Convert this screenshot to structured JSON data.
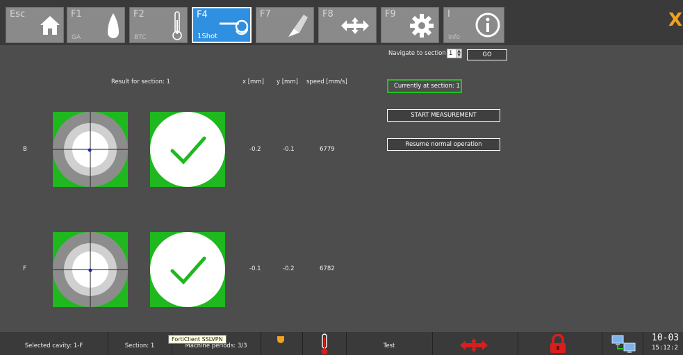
{
  "toolbar": {
    "keys": [
      {
        "key": "Esc",
        "sub": "",
        "icon": "home-icon"
      },
      {
        "key": "F1",
        "sub": "GA",
        "icon": "drop-icon"
      },
      {
        "key": "F2",
        "sub": "BTC",
        "icon": "thermometer-icon"
      },
      {
        "key": "F4",
        "sub": "1Shot",
        "icon": "probe-icon"
      },
      {
        "key": "F7",
        "sub": "",
        "icon": "brush-icon"
      },
      {
        "key": "F8",
        "sub": "",
        "icon": "arrows-icon"
      },
      {
        "key": "F9",
        "sub": "",
        "icon": "gear-icon"
      },
      {
        "key": "I",
        "sub": "Info",
        "icon": "info-icon"
      }
    ],
    "close_label": "X",
    "accent": "#f2a21f",
    "active_color": "#2f8fe0"
  },
  "results": {
    "title": "Result for section: 1",
    "col_x": "x [mm]",
    "col_y": "y [mm]",
    "col_speed": "speed [mm/s]",
    "rows": [
      {
        "label": "B",
        "x": "-0.2",
        "y": "-0.1",
        "speed": "6779"
      },
      {
        "label": "F",
        "x": "-0.1",
        "y": "-0.2",
        "speed": "6782"
      }
    ],
    "ok_color": "#1fb81f"
  },
  "navigation": {
    "label": "Navigate to section",
    "selected": "1",
    "go_label": "GO",
    "current_text": "Currently at section: 1",
    "start_label": "START MEASUREMENT",
    "resume_label": "Resume normal operation"
  },
  "status": {
    "cavity": "Selected cavity: 1-F",
    "section": "Section: 1",
    "periods": "Machine periods: 3/3",
    "mode": "Test",
    "tooltip": "FortiClient SSLVPN",
    "clock_top": "10-03",
    "clock_bottom": "15:12:2"
  }
}
